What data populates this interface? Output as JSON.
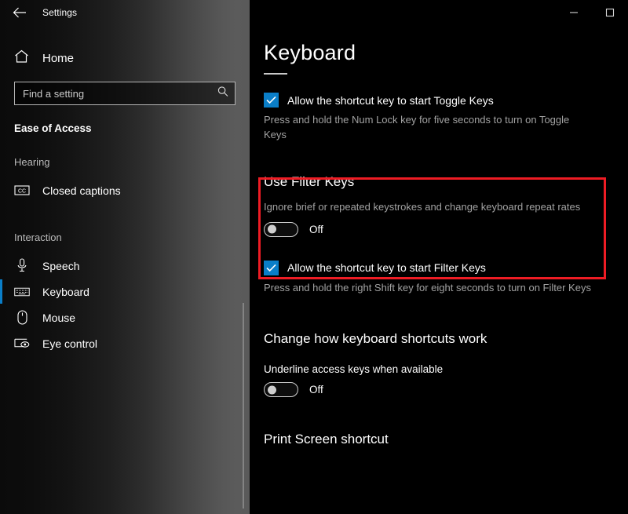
{
  "window": {
    "app_title": "Settings",
    "back_icon": "back-arrow-icon",
    "minimize_label": "–",
    "maximize_label": "□"
  },
  "sidebar": {
    "home_label": "Home",
    "home_icon": "home-icon",
    "search": {
      "placeholder": "Find a setting",
      "value": "",
      "icon": "search-icon"
    },
    "category_title": "Ease of Access",
    "groups": [
      {
        "label": "Hearing",
        "items": [
          {
            "label": "Closed captions",
            "icon": "closed-captions-icon",
            "selected": false
          }
        ]
      },
      {
        "label": "Interaction",
        "items": [
          {
            "label": "Speech",
            "icon": "microphone-icon",
            "selected": false
          },
          {
            "label": "Keyboard",
            "icon": "keyboard-icon",
            "selected": true
          },
          {
            "label": "Mouse",
            "icon": "mouse-icon",
            "selected": false
          },
          {
            "label": "Eye control",
            "icon": "eye-control-icon",
            "selected": false
          }
        ]
      }
    ]
  },
  "main": {
    "page_title": "Keyboard",
    "toggle_keys": {
      "checkbox_label": "Allow the shortcut key to start Toggle Keys",
      "checked": true,
      "description": "Press and hold the Num Lock key for five seconds to turn on Toggle Keys"
    },
    "filter_keys": {
      "heading": "Use Filter Keys",
      "description": "Ignore brief or repeated keystrokes and change keyboard repeat rates",
      "toggle_state": "Off",
      "toggle_on": false
    },
    "filter_keys_shortcut": {
      "checkbox_label": "Allow the shortcut key to start Filter Keys",
      "checked": true,
      "description": "Press and hold the right Shift key for eight seconds to turn on Filter Keys"
    },
    "shortcuts_section": {
      "heading": "Change how keyboard shortcuts work",
      "underline_label": "Underline access keys when available",
      "toggle_state": "Off",
      "toggle_on": false
    },
    "print_screen_section": {
      "heading": "Print Screen shortcut"
    }
  },
  "annotation": {
    "highlight_color": "#ee1c24",
    "target": "Use Filter Keys"
  },
  "colors": {
    "accent": "#0a7ec8",
    "background": "#000000",
    "text_primary": "#ffffff",
    "text_secondary": "#a2a2a2"
  }
}
